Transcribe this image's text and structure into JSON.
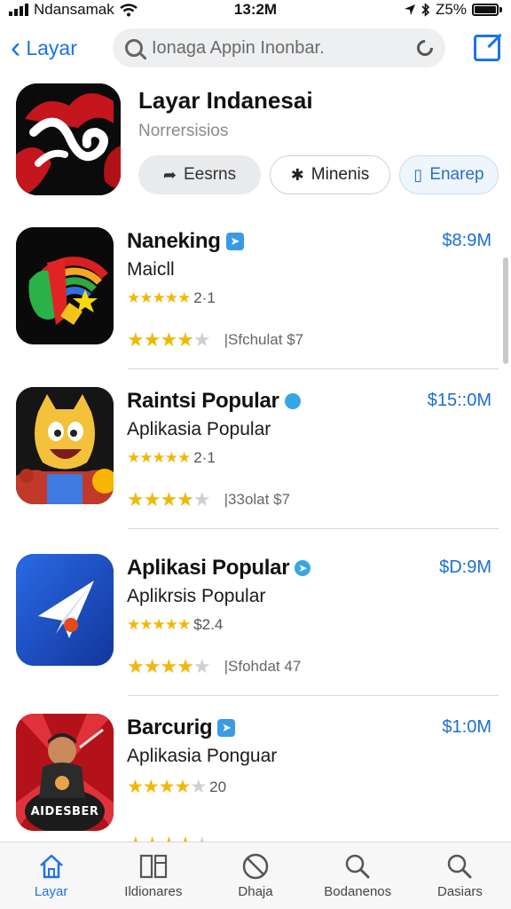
{
  "status_bar": {
    "carrier": "Ndansamak",
    "time": "13:2M",
    "battery": "Z5%"
  },
  "nav": {
    "back_label": "Layar",
    "search_placeholder": "Ionaga Appin Inonbar."
  },
  "header_app": {
    "title": "Layar Indanesai",
    "subtitle": "Norrersisios",
    "buttons": [
      {
        "label": "Eesrns",
        "icon": "share-icon"
      },
      {
        "label": "Minenis",
        "icon": "puzzle-icon"
      },
      {
        "label": "Enarep",
        "icon": "trash-icon"
      }
    ]
  },
  "apps": [
    {
      "name": "Naneking",
      "badge": "square",
      "subtitle": "Maicll",
      "price": "$8:9M",
      "small_rating_text": "2·1",
      "small_stars": 5,
      "large_stars": 4,
      "count_text": "|Sfchulat $7",
      "icon": "rainbow-hand-icon"
    },
    {
      "name": "Raintsi Popular",
      "badge": "dot",
      "subtitle": "Aplikasia Popular",
      "price": "$15::0M",
      "small_rating_text": "2·1",
      "small_stars": 5,
      "large_stars": 4,
      "count_text": "|33olat $7",
      "icon": "cartoon-character-icon"
    },
    {
      "name": "Aplikasi Popular",
      "badge": "dot",
      "subtitle": "Aplikrsis Popular",
      "price": "$D:9M",
      "small_rating_text": "$2.4",
      "small_stars": 5,
      "large_stars": 4,
      "count_text": "|Sfohdat 47",
      "icon": "paper-plane-icon"
    },
    {
      "name": "Barcurig",
      "badge": "square",
      "subtitle": "Aplikasia Ponguar",
      "price": "$1:0M",
      "small_rating_text": "20",
      "small_stars": 4,
      "large_stars": 4,
      "count_text": "",
      "icon": "musician-poster-icon",
      "icon_caption": "AIDESBER"
    }
  ],
  "tabs": [
    {
      "label": "Layar",
      "icon": "home-icon",
      "active": true
    },
    {
      "label": "Ildionares",
      "icon": "books-icon",
      "active": false
    },
    {
      "label": "Dhaja",
      "icon": "blocked-icon",
      "active": false
    },
    {
      "label": "Bodanenos",
      "icon": "search-icon",
      "active": false
    },
    {
      "label": "Dasiars",
      "icon": "search-icon",
      "active": false
    }
  ],
  "colors": {
    "accent": "#1a73e8",
    "star": "#f2b705",
    "price": "#1a6fd0"
  }
}
